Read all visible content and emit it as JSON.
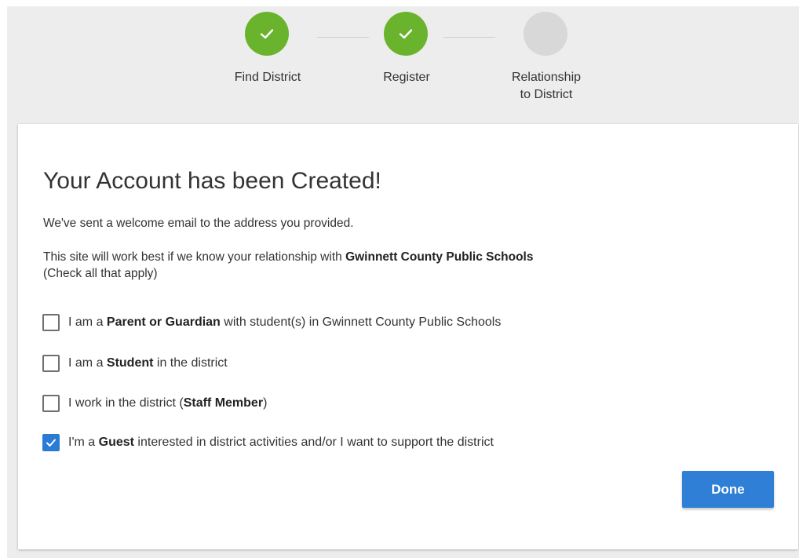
{
  "stepper": {
    "steps": [
      {
        "line1": "Find District",
        "line2": "",
        "status": "complete"
      },
      {
        "line1": "Register",
        "line2": "",
        "status": "complete"
      },
      {
        "line1": "Relationship",
        "line2": "to District",
        "status": "pending"
      }
    ],
    "colors": {
      "complete": "#6ab42d",
      "pending": "#d8d8d8"
    }
  },
  "card": {
    "title": "Your Account has been Created!",
    "welcome_text": "We've sent a welcome email to the address you provided.",
    "relationship_prefix": "This site will work best if we know your relationship with ",
    "district_name": "Gwinnett County Public Schools",
    "check_note": "(Check all that apply)",
    "options": [
      {
        "prefix": "I am a ",
        "bold": "Parent or Guardian",
        "suffix": " with student(s) in Gwinnett County Public Schools",
        "checked": false
      },
      {
        "prefix": "I am a ",
        "bold": "Student",
        "suffix": " in the district",
        "checked": false
      },
      {
        "prefix": "I work in the district (",
        "bold": "Staff Member",
        "suffix": ")",
        "checked": false
      },
      {
        "prefix": "I'm a ",
        "bold": "Guest",
        "suffix": " interested in district activities and/or I want to support the district",
        "checked": true
      }
    ],
    "done_label": "Done",
    "accent_color": "#2f7fd6"
  }
}
